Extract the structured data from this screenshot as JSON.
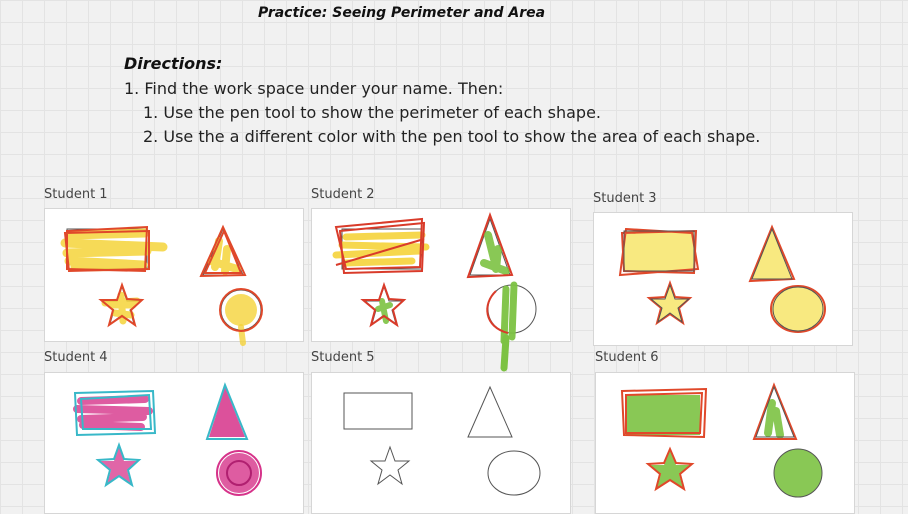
{
  "title": "Practice: Seeing Perimeter and Area",
  "directions": {
    "heading": "Directions:",
    "step1": "1. Find the work space under your name.  Then:",
    "sub1": "1. Use the pen tool to show the perimeter of each shape.",
    "sub2": "2. Use the a different color with the pen tool to show the area of each shape."
  },
  "students": [
    {
      "name": "Student 1",
      "perimeter_color": "#e0482a",
      "area_color": "#f5d33a"
    },
    {
      "name": "Student 2",
      "perimeter_color": "#d93b2a",
      "area_color": "#7cc242"
    },
    {
      "name": "Student 3",
      "perimeter_color": "#e0482a",
      "area_color": "#f7e56a"
    },
    {
      "name": "Student 4",
      "perimeter_color": "#38b8c8",
      "area_color": "#d6338a"
    },
    {
      "name": "Student 5",
      "perimeter_color": "",
      "area_color": ""
    },
    {
      "name": "Student 6",
      "perimeter_color": "#e0482a",
      "area_color": "#7cc242"
    }
  ],
  "icons": [
    "rectangle-shape",
    "triangle-shape",
    "star-shape",
    "circle-shape"
  ]
}
